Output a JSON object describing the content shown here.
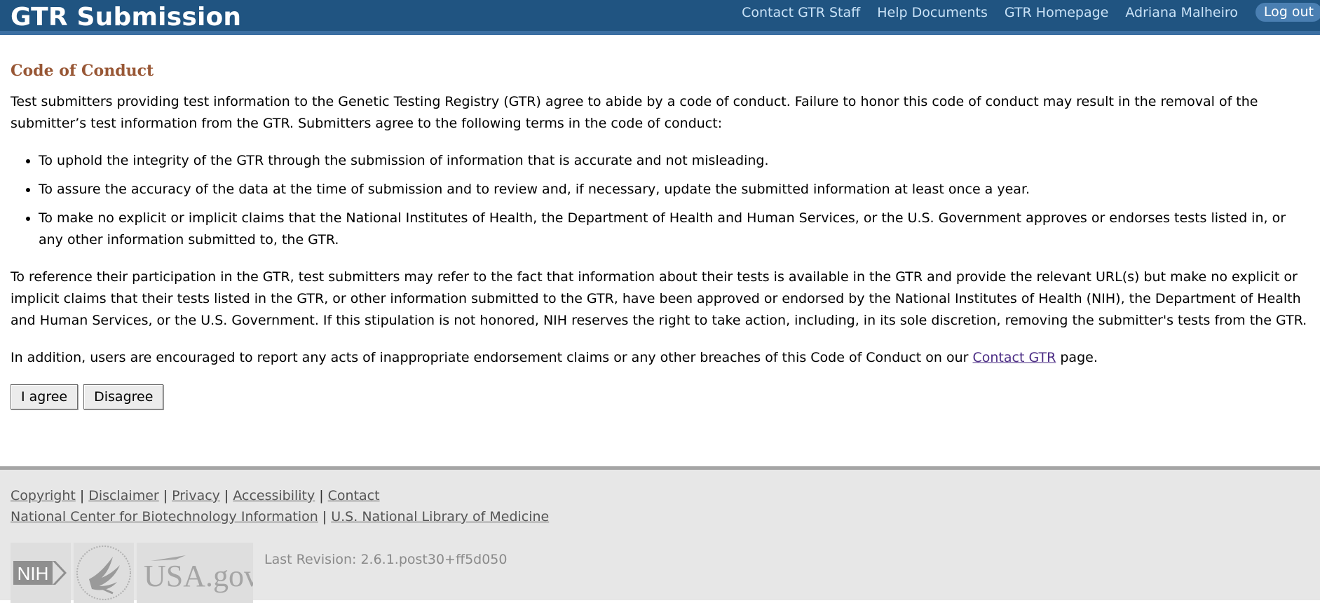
{
  "header": {
    "title": "GTR Submission",
    "nav": {
      "contact_staff": "Contact GTR Staff",
      "help_documents": "Help Documents",
      "homepage": "GTR Homepage",
      "user_name": "Adriana Malheiro",
      "logout": "Log out"
    }
  },
  "main": {
    "heading": "Code of Conduct",
    "intro": "Test submitters providing test information to the Genetic Testing Registry (GTR) agree to abide by a code of conduct. Failure to honor this code of conduct may result in the removal of the submitter’s test information from the GTR.  Submitters agree to the following terms in the code of conduct:",
    "terms": [
      "To uphold the integrity of the GTR through the submission of information that is accurate and not misleading.",
      "To assure the accuracy of the data at the time of submission and to review and, if necessary, update the submitted information at least once a year.",
      "To make no explicit or implicit claims that the National Institutes of Health, the Department of Health and Human Services, or the U.S. Government approves or endorses tests listed in, or any other information submitted to, the GTR."
    ],
    "reference_paragraph": "To reference their participation in the GTR, test submitters may refer to the fact that information about their tests is available in the GTR and provide the relevant URL(s) but make no explicit or implicit claims that their tests listed in the GTR, or other information submitted to the GTR, have been approved or endorsed by the National Institutes of Health (NIH), the Department of Health and Human Services, or the U.S. Government. If this stipulation is not honored, NIH reserves the right to take action, including, in its sole discretion, removing the submitter's tests from the GTR.",
    "report_prefix": "In addition, users are encouraged to report any acts of inappropriate endorsement claims or any other breaches of this Code of Conduct on our ",
    "report_link": "Contact GTR",
    "report_suffix": " page.",
    "agree_button": "I agree",
    "disagree_button": "Disagree"
  },
  "footer": {
    "links_row1": [
      "Copyright",
      "Disclaimer",
      "Privacy",
      "Accessibility",
      "Contact"
    ],
    "links_row2": [
      "National Center for Biotechnology Information",
      "U.S. National Library of Medicine"
    ],
    "separator": "|",
    "logos": {
      "nih": "NIH",
      "usa_gov": "USA.gov"
    },
    "revision": "Last Revision: 2.6.1.post30+ff5d050"
  }
}
